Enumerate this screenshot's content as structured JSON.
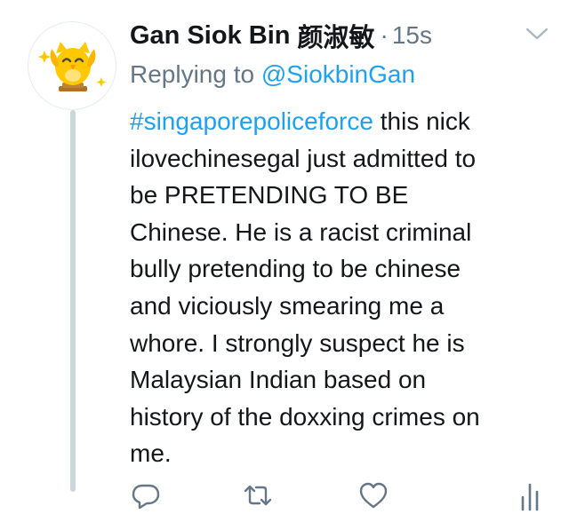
{
  "tweet": {
    "author_name": "Gan Siok Bin",
    "author_name_cjk": "颜淑敏",
    "separator": "·",
    "timestamp": "15s",
    "replying_prefix": "Replying to ",
    "replying_to": "@SiokbinGan",
    "hashtag": "#singaporepoliceforce",
    "text": " this nick\nilovechinesegal just admitted to\nbe PRETENDING TO BE\nChinese. He is a racist criminal\nbully pretending to be chinese\nand viciously smearing me a\nwhore. I strongly suspect he is\nMalaysian Indian based on\nhistory of the doxxing crimes on\nme."
  },
  "icons": {
    "avatar": "owl-avatar",
    "menu": "chevron-down-icon",
    "reply": "reply-icon",
    "retweet": "retweet-icon",
    "like": "heart-icon",
    "analytics": "analytics-icon"
  },
  "colors": {
    "link": "#1da1f2",
    "muted": "#657786",
    "thread_line": "#ccd6dd",
    "owl_body": "#ffc800",
    "owl_beak": "#ff9600",
    "pedestal": "#c4822c"
  }
}
